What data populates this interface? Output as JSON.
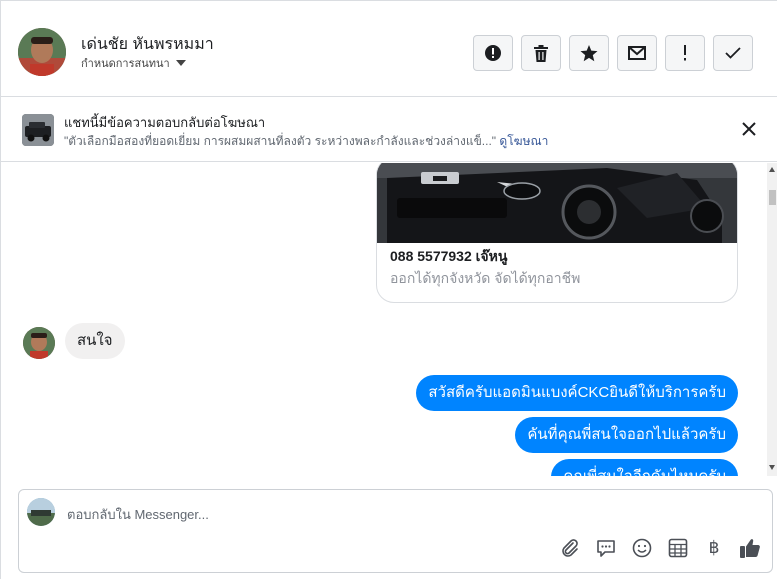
{
  "header": {
    "contact_name": "เด่นชัย หันพรหมมา",
    "chat_label": "กำหนดการสนทนา",
    "actions": [
      {
        "name": "report-button",
        "icon": "exclamation-circle-icon"
      },
      {
        "name": "delete-button",
        "icon": "trash-icon"
      },
      {
        "name": "star-button",
        "icon": "star-icon"
      },
      {
        "name": "mark-unread-button",
        "icon": "envelope-icon"
      },
      {
        "name": "spam-button",
        "icon": "exclamation-icon"
      },
      {
        "name": "done-button",
        "icon": "check-icon"
      }
    ]
  },
  "banner": {
    "title": "แชทนี้มีข้อความตอบกลับต่อโฆษณา",
    "quote": "\"ตัวเลือกมือสองที่ยอดเยี่ยม การผสมผสานที่ลงตัว ระหว่างพละกำลังและช่วงล่างแข็...\"",
    "link": "ดูโฆษณา"
  },
  "card": {
    "title": "088 5577932 เจ๊หนู",
    "subtitle": "ออกได้ทุกจังหวัด จัดได้ทุกอาชีพ"
  },
  "messages": {
    "incoming": "สนใจ",
    "outgoing": [
      "สวัสดีครับแอดมินแบงค์CKCยินดีให้บริการครับ",
      "คันที่คุณพี่สนใจออกไปแล้วครับ",
      "คุณพี่สนใจอีกคันไหมครับ"
    ]
  },
  "composer": {
    "placeholder": "ตอบกลับใน Messenger...",
    "tools": [
      "paperclip-icon",
      "chat-bubble-icon",
      "emoji-icon",
      "table-icon",
      "baht-icon",
      "thumbs-up-icon"
    ],
    "baht_symbol": "฿"
  },
  "colors": {
    "accent": "#0084ff",
    "link": "#385898",
    "bubble_in": "#f1f0f0"
  }
}
